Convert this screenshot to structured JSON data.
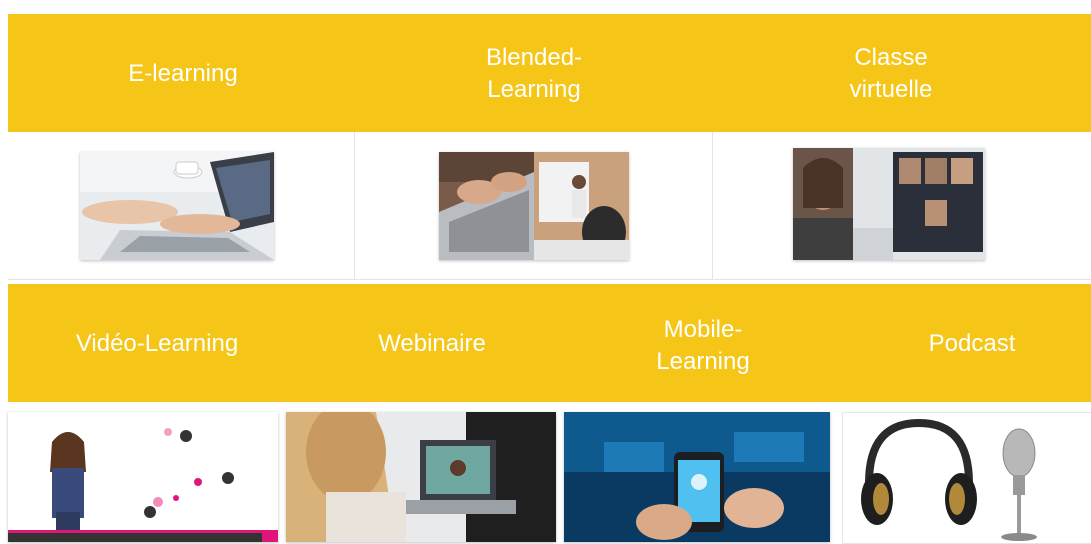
{
  "colors": {
    "band": "#f5c518",
    "label": "#ffffff"
  },
  "top_band": {
    "items": [
      {
        "label": "E-learning"
      },
      {
        "label": "Blended-\nLearning"
      },
      {
        "label": "Classe\nvirtuelle"
      }
    ]
  },
  "bottom_band": {
    "items": [
      {
        "label": "Vidéo-Learning"
      },
      {
        "label": "Webinaire"
      },
      {
        "label": "Mobile-\nLearning"
      },
      {
        "label": "Podcast"
      }
    ]
  },
  "images": {
    "top": [
      "laptop-typing-image",
      "blended-classroom-image",
      "virtual-class-image"
    ],
    "bottom": [
      "presenter-video-image",
      "webinar-laptop-image",
      "mobile-tablet-image",
      "podcast-microphone-image"
    ]
  }
}
